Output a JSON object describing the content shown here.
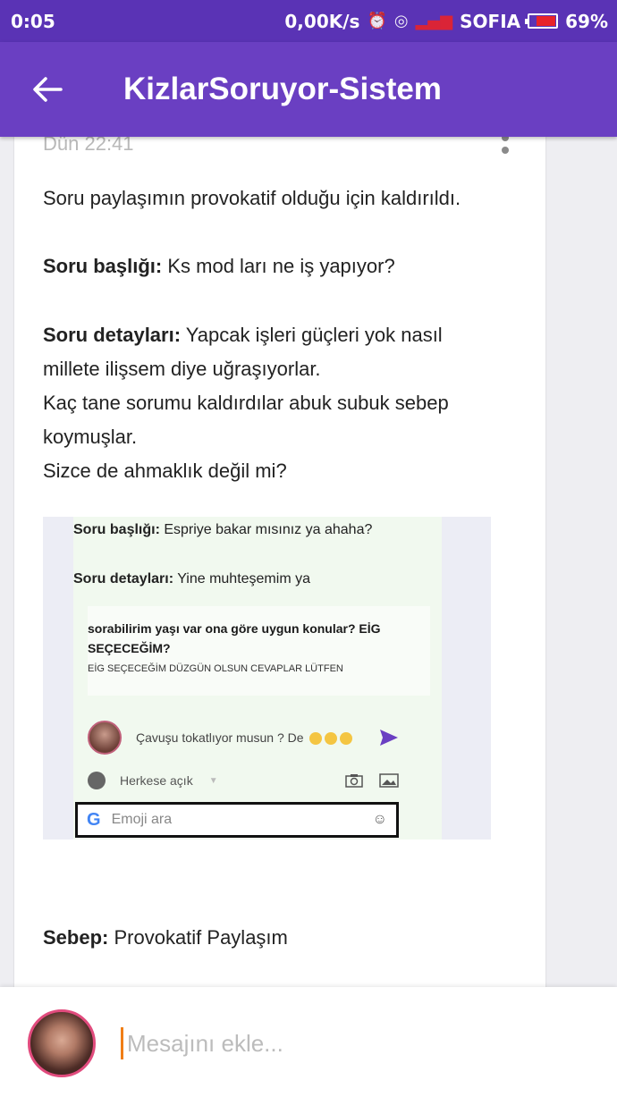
{
  "status_bar": {
    "time": "0:05",
    "net_speed": "0,00K/s",
    "carrier": "SOFIA",
    "battery": "69%",
    "battery_level": 0.69
  },
  "toolbar": {
    "title": "KizlarSoruyor-Sistem",
    "back_icon": "arrow-left-icon"
  },
  "message": {
    "timestamp": "Dün 22:41",
    "intro": "Soru paylaşımın provokatif olduğu için kaldırıldı.",
    "title_label": "Soru başlığı:",
    "title_value": " Ks mod ları ne iş yapıyor?",
    "details_label": "Soru detayları:",
    "details_line1": " Yapcak işleri güçleri yok nasıl",
    "details_line2": "millete ilişsem diye uğraşıyorlar.",
    "details_line3": "Kaç tane sorumu kaldırdılar abuk subuk sebep",
    "details_line4": "koymuşlar.",
    "details_line5": "Sizce de ahmaklık değil mi?",
    "reason_label": "Sebep:",
    "reason_value": " Provokatif Paylaşım"
  },
  "screenshot": {
    "title_label": "Soru başlığı:",
    "title_value": " Espriye bakar mısınız ya ahaha?",
    "details_label": "Soru detayları:",
    "details_value": " Yine muhteşemim ya",
    "q_line1": "sorabilirim yaşı var ona göre uygun konular? EİG",
    "q_line2": "SEÇECEĞİM?",
    "q_small": "EİG SEÇECEĞİM DÜZGÜN OLSUN CEVAPLAR LÜTFEN",
    "comment_text": "Çavuşu tokatlıyor musun ? De",
    "privacy": "Herkese açık",
    "search_placeholder": "Emoji ara"
  },
  "composer": {
    "placeholder": "Mesajını ekle..."
  },
  "colors": {
    "status_bar": "#5a33b5",
    "toolbar": "#6a3fc2",
    "cursor": "#f07e16",
    "avatar_ring": "#e14b7d"
  }
}
